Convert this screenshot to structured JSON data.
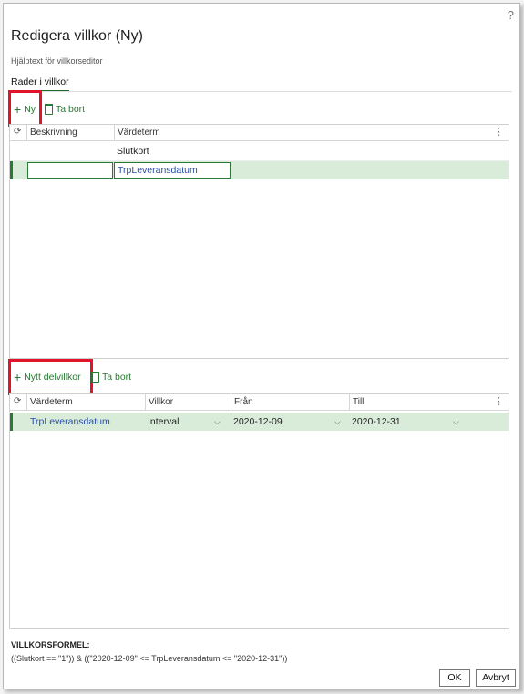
{
  "dialog": {
    "help_icon": "?",
    "title": "Redigera villkor (Ny)",
    "help_text": "Hjälptext för villkorseditor",
    "tab_label": "Rader i villkor"
  },
  "rows_toolbar": {
    "new_label": "Ny",
    "delete_label": "Ta bort"
  },
  "rows_grid": {
    "columns": [
      "Beskrivning",
      "Värdeterm"
    ],
    "rows": [
      {
        "description": "",
        "value_term": "Slutkort"
      },
      {
        "description": "",
        "value_term": "TrpLeveransdatum"
      }
    ]
  },
  "sub_toolbar": {
    "new_label": "Nytt delvillkor",
    "delete_label": "Ta bort"
  },
  "sub_grid": {
    "columns": [
      "Värdeterm",
      "Villkor",
      "Från",
      "Till"
    ],
    "row": {
      "value_term": "TrpLeveransdatum",
      "condition": "Intervall",
      "from": "2020-12-09",
      "to": "2020-12-31"
    }
  },
  "formula": {
    "label": "VILLKORSFORMEL:",
    "text": "((Slutkort == \"1\")) & ((\"2020-12-09\" <= TrpLeveransdatum <= \"2020-12-31\"))"
  },
  "buttons": {
    "ok": "OK",
    "cancel": "Avbryt"
  },
  "colors": {
    "accent": "#2a7a36",
    "highlight": "#e0142a",
    "selected_row": "#d8ecd9",
    "link": "#2b4fa8"
  }
}
